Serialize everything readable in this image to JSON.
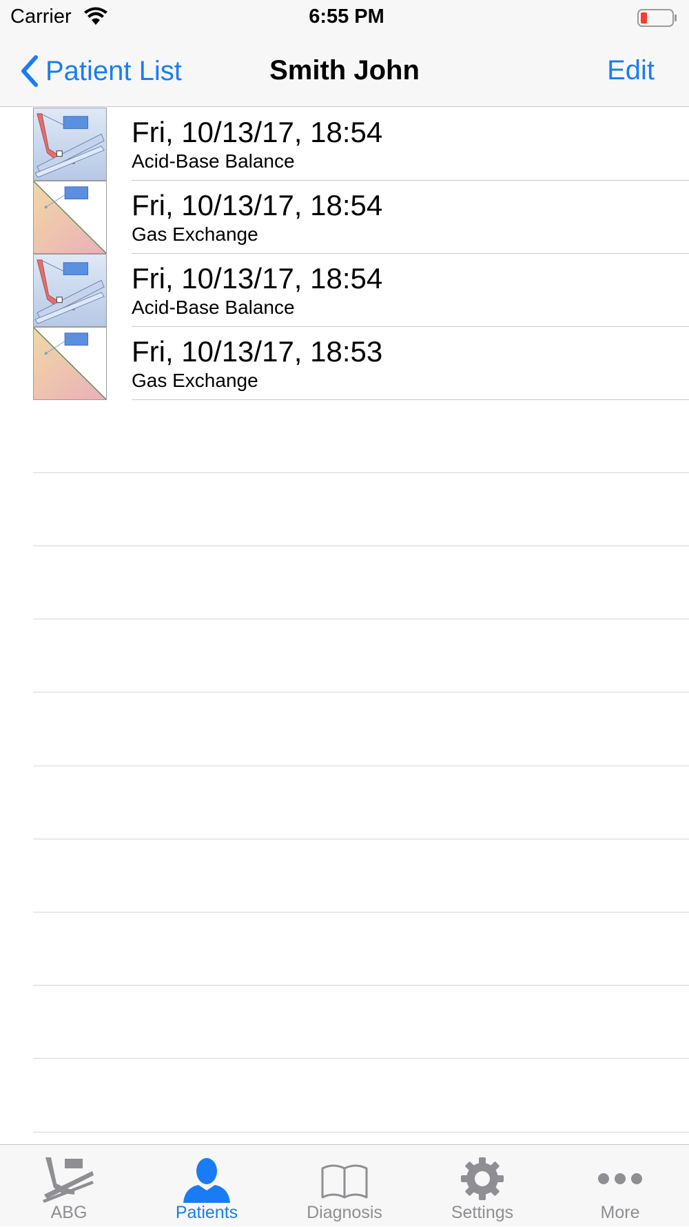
{
  "status_bar": {
    "carrier": "Carrier",
    "time": "6:55 PM",
    "battery_color": "#ff3b30"
  },
  "nav_bar": {
    "back_label": "Patient List",
    "title": "Smith John",
    "edit_label": "Edit",
    "accent_color": "#1a7cf5"
  },
  "records": [
    {
      "title": "Fri, 10/13/17, 18:54",
      "subtitle": "Acid-Base Balance",
      "icon": "acid-base-chart-icon"
    },
    {
      "title": "Fri, 10/13/17, 18:54",
      "subtitle": "Gas Exchange",
      "icon": "gas-exchange-chart-icon"
    },
    {
      "title": "Fri, 10/13/17, 18:54",
      "subtitle": "Acid-Base Balance",
      "icon": "acid-base-chart-icon"
    },
    {
      "title": "Fri, 10/13/17, 18:53",
      "subtitle": "Gas Exchange",
      "icon": "gas-exchange-chart-icon"
    }
  ],
  "tab_bar": {
    "tabs": [
      {
        "label": "ABG",
        "icon": "abg-chart-icon",
        "active": false
      },
      {
        "label": "Patients",
        "icon": "person-icon",
        "active": true
      },
      {
        "label": "Diagnosis",
        "icon": "book-icon",
        "active": false
      },
      {
        "label": "Settings",
        "icon": "gear-icon",
        "active": false
      },
      {
        "label": "More",
        "icon": "ellipsis-icon",
        "active": false
      }
    ]
  }
}
